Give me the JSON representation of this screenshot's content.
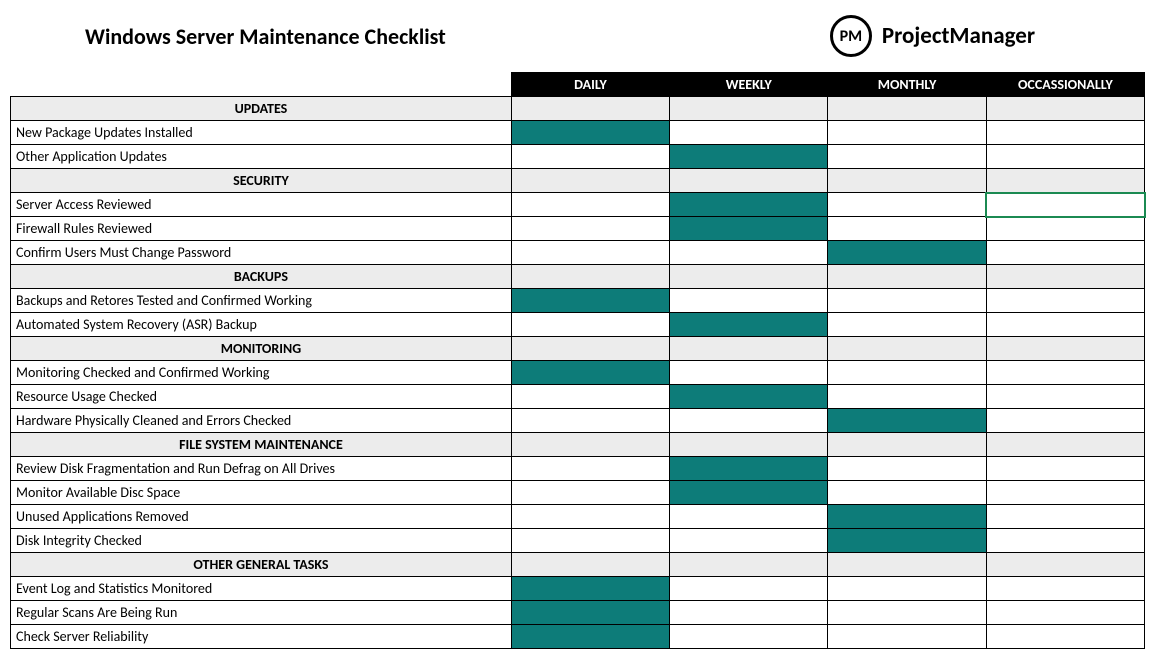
{
  "title": "Windows Server Maintenance Checklist",
  "brand": {
    "badge": "PM",
    "name": "ProjectManager"
  },
  "colors": {
    "accent": "#0d7c79",
    "header_bg": "#000000",
    "section_bg": "#ececec"
  },
  "columns": [
    "DAILY",
    "WEEKLY",
    "MONTHLY",
    "OCCASSIONALLY"
  ],
  "sections": [
    {
      "name": "UPDATES",
      "tasks": [
        {
          "label": "New Package Updates Installed",
          "freq": [
            true,
            false,
            false,
            false
          ]
        },
        {
          "label": "Other Application Updates",
          "freq": [
            false,
            true,
            false,
            false
          ]
        }
      ]
    },
    {
      "name": "SECURITY",
      "tasks": [
        {
          "label": "Server Access Reviewed",
          "freq": [
            false,
            true,
            false,
            false
          ],
          "selected_cell": 3
        },
        {
          "label": "Firewall Rules Reviewed",
          "freq": [
            false,
            true,
            false,
            false
          ]
        },
        {
          "label": "Confirm Users Must Change Password",
          "freq": [
            false,
            false,
            true,
            false
          ]
        }
      ]
    },
    {
      "name": "BACKUPS",
      "tasks": [
        {
          "label": "Backups and Retores Tested and Confirmed Working",
          "freq": [
            true,
            false,
            false,
            false
          ]
        },
        {
          "label": "Automated System Recovery (ASR) Backup",
          "freq": [
            false,
            true,
            false,
            false
          ]
        }
      ]
    },
    {
      "name": "MONITORING",
      "tasks": [
        {
          "label": "Monitoring Checked and Confirmed Working",
          "freq": [
            true,
            false,
            false,
            false
          ]
        },
        {
          "label": "Resource Usage Checked",
          "freq": [
            false,
            true,
            false,
            false
          ]
        },
        {
          "label": "Hardware Physically Cleaned and Errors Checked",
          "freq": [
            false,
            false,
            true,
            false
          ]
        }
      ]
    },
    {
      "name": "FILE SYSTEM MAINTENANCE",
      "tasks": [
        {
          "label": "Review Disk Fragmentation and Run Defrag on All Drives",
          "freq": [
            false,
            true,
            false,
            false
          ]
        },
        {
          "label": "Monitor Available Disc Space",
          "freq": [
            false,
            true,
            false,
            false
          ]
        },
        {
          "label": "Unused Applications Removed",
          "freq": [
            false,
            false,
            true,
            false
          ]
        },
        {
          "label": "Disk Integrity Checked",
          "freq": [
            false,
            false,
            true,
            false
          ]
        }
      ]
    },
    {
      "name": "OTHER GENERAL TASKS",
      "tasks": [
        {
          "label": "Event Log and Statistics Monitored",
          "freq": [
            true,
            false,
            false,
            false
          ]
        },
        {
          "label": "Regular Scans Are Being Run",
          "freq": [
            true,
            false,
            false,
            false
          ]
        },
        {
          "label": "Check Server Reliability",
          "freq": [
            true,
            false,
            false,
            false
          ]
        }
      ]
    }
  ]
}
